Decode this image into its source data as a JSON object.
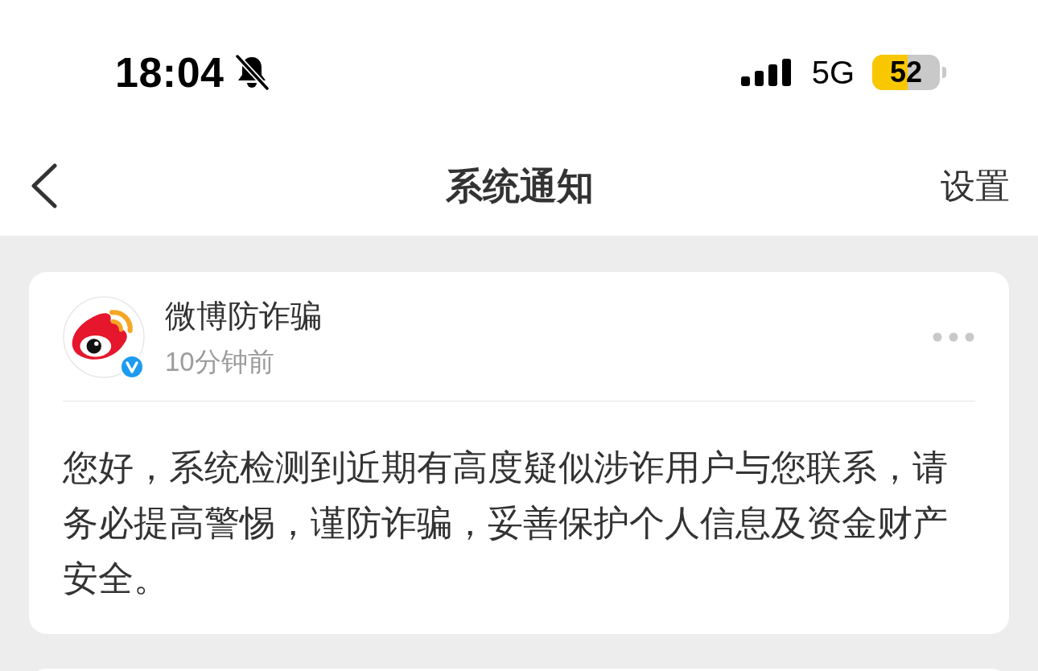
{
  "status_bar": {
    "time": "18:04",
    "silent": true,
    "network": "5G",
    "battery": {
      "level": 0.52,
      "reading": "52"
    }
  },
  "nav_bar": {
    "title": "系统通知",
    "action": "设置"
  },
  "notifications": [
    {
      "sender": "微博防诈骗",
      "verified": true,
      "time": "10分钟前",
      "body": "您好，系统检测到近期有高度疑似涉诈用户与您联系，请务必提高警惕，谨防诈骗，妥善保护个人信息及资金财产安全。"
    }
  ]
}
